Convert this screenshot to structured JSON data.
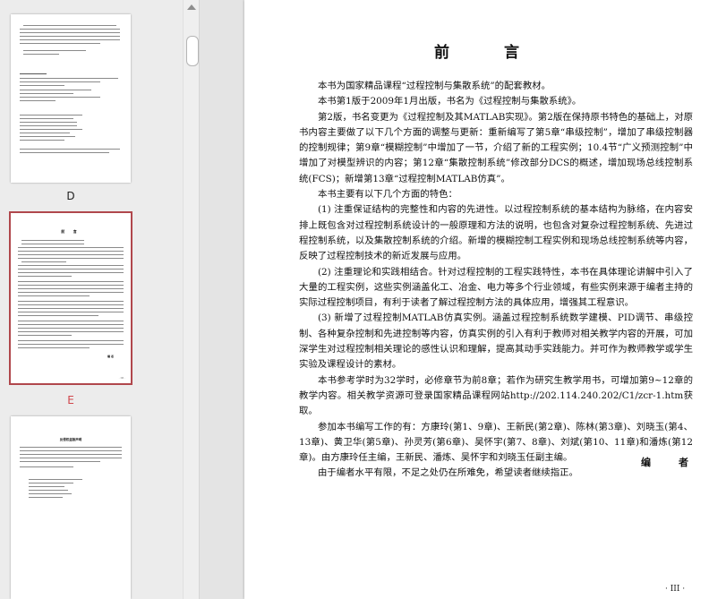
{
  "sidebar": {
    "thumbnails": [
      {
        "label": "D",
        "selected": false
      },
      {
        "label": "E",
        "selected": true,
        "mini_title": "前 言",
        "mini_signature": "编 者",
        "mini_page": "· III ·"
      },
      {
        "label": "",
        "selected": false,
        "mini_title": "反侵权盗版声明"
      }
    ],
    "selected_color": "#d0474c"
  },
  "page": {
    "title": "前　言",
    "paragraphs": [
      "本书为国家精品课程“过程控制与集散系统”的配套教材。",
      "本书第1版于2009年1月出版，书名为《过程控制与集散系统》。",
      "第2版，书名变更为《过程控制及其MATLAB实现》。第2版在保持原书特色的基础上，对原书内容主要做了以下几个方面的调整与更新：重新编写了第5章“串级控制”，增加了串级控制器的控制规律；第9章“模糊控制”中增加了一节，介绍了新的工程实例；10.4节“广义预测控制”中增加了对模型辨识的内容；第12章“集散控制系统”修改部分DCS的概述，增加现场总线控制系统(FCS)；新增第13章“过程控制MATLAB仿真”。",
      "本书主要有以下几个方面的特色：",
      "(1) 注重保证结构的完整性和内容的先进性。以过程控制系统的基本结构为脉络，在内容安排上既包含对过程控制系统设计的一般原理和方法的说明，也包含对复杂过程控制系统、先进过程控制系统，以及集散控制系统的介绍。新增的模糊控制工程实例和现场总线控制系统等内容，反映了过程控制技术的新近发展与应用。",
      "(2) 注重理论和实践相结合。针对过程控制的工程实践特性，本书在具体理论讲解中引入了大量的工程实例，这些实例涵盖化工、冶金、电力等多个行业领域，有些实例来源于编者主持的实际过程控制项目，有利于读者了解过程控制方法的具体应用，增强其工程意识。",
      "(3) 新增了过程控制MATLAB仿真实例。涵盖过程控制系统数学建模、PID调节、串级控制、各种复杂控制和先进控制等内容，仿真实例的引入有利于教师对相关教学内容的开展，可加深学生对过程控制相关理论的感性认识和理解，提高其动手实践能力。并可作为教师教学或学生实验及课程设计的素材。",
      "本书参考学时为32学时，必修章节为前8章；若作为研究生教学用书，可增加第9~12章的教学内容。相关教学资源可登录国家精品课程网站http://202.114.240.202/C1/zcr-1.htm获取。",
      "参加本书编写工作的有：方康玲(第1、9章)、王新民(第2章)、陈林(第3章)、刘晓玉(第4、13章)、黄卫华(第5章)、孙灵芳(第6章)、吴怀宇(第7、8章)、刘斌(第10、11章)和潘炼(第12章)。由方康玲任主编，王新民、潘炼、吴怀宇和刘晓玉任副主编。",
      "由于编者水平有限，不足之处仍在所难免，希望读者继续指正。"
    ],
    "signature": "编　者",
    "page_number": "· III ·"
  }
}
